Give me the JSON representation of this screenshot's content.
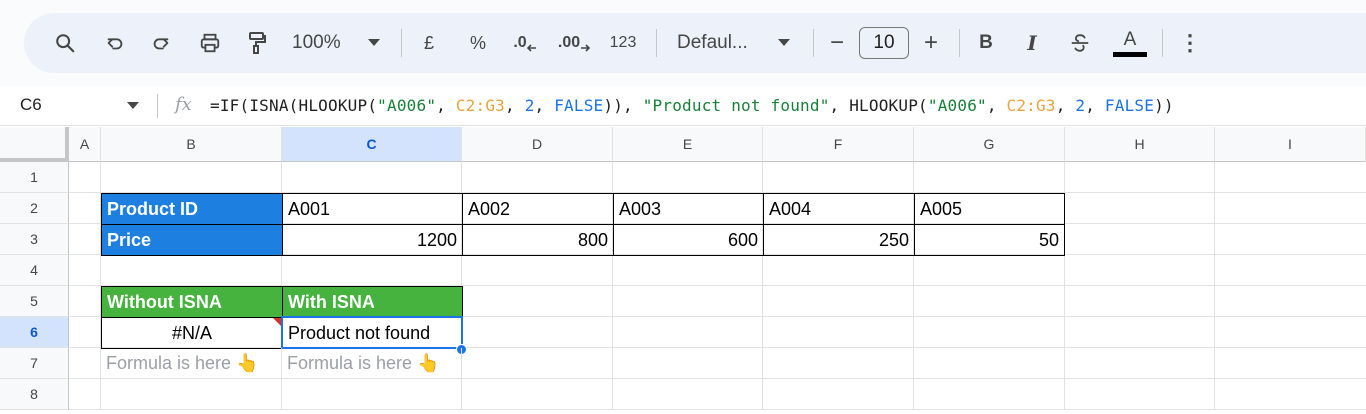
{
  "toolbar": {
    "zoom": "100%",
    "currency": "£",
    "percent": "%",
    "decrease_decimal": ".0",
    "increase_decimal": ".00",
    "number_format": "123",
    "font": "Defaul...",
    "font_size": "10",
    "minus": "−",
    "plus": "+",
    "bold": "B",
    "italic": "I",
    "text_color": "A",
    "more": "⋮"
  },
  "formula_bar": {
    "name_box": "C6",
    "fx": "fx",
    "parts": {
      "p1": "=IF(ISNA(HLOOKUP(",
      "s1": "\"A006\"",
      "p2": ", ",
      "r1": "C2:G3",
      "p3": ", ",
      "n1": "2",
      "p4": ", ",
      "b1": "FALSE",
      "p5": ")), ",
      "s2": "\"Product not found\"",
      "p6": ", HLOOKUP(",
      "s3": "\"A006\"",
      "p7": ", ",
      "r2": "C2:G3",
      "p8": ", ",
      "n2": "2",
      "p9": ", ",
      "b2": "FALSE",
      "p10": "))"
    }
  },
  "columns": [
    "A",
    "B",
    "C",
    "D",
    "E",
    "F",
    "G",
    "H",
    "I"
  ],
  "rows": [
    "1",
    "2",
    "3",
    "4",
    "5",
    "6",
    "7",
    "8"
  ],
  "cells": {
    "B2": "Product ID",
    "C2": "A001",
    "D2": "A002",
    "E2": "A003",
    "F2": "A004",
    "G2": "A005",
    "B3": "Price",
    "C3": "1200",
    "D3": "800",
    "E3": "600",
    "F3": "250",
    "G3": "50",
    "B5": "Without ISNA",
    "C5": "With ISNA",
    "B6": "#N/A",
    "C6": "Product not found",
    "B7": "Formula is here 👆",
    "C7": "Formula is here 👆"
  },
  "colors": {
    "header_blue": "#1d7fe0",
    "header_green": "#45b33e",
    "selection": "#1a73e8",
    "error_marker": "#d93025"
  }
}
